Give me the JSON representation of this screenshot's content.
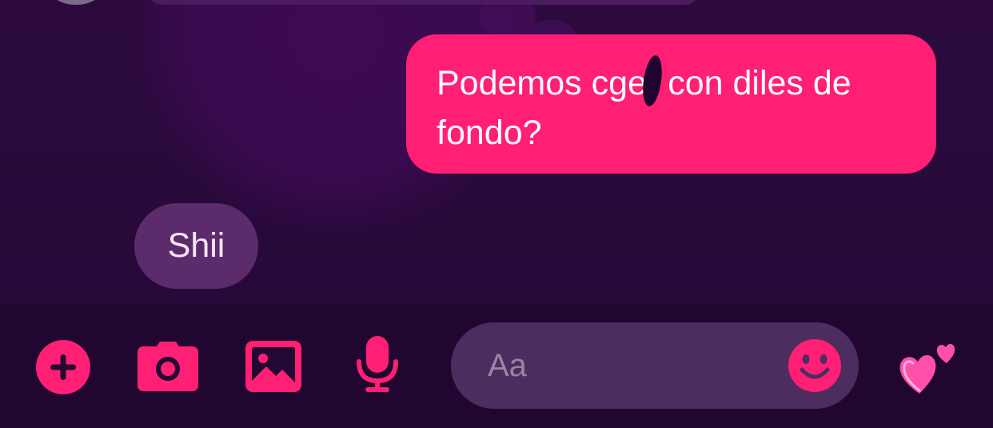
{
  "conversation": {
    "messages": [
      {
        "direction": "outgoing",
        "text_before": "Podemos c",
        "text_after": "ger con diles de fondo?"
      },
      {
        "direction": "incoming",
        "text": "Shii"
      }
    ]
  },
  "composer": {
    "placeholder": "Aa",
    "icons": [
      "add-icon",
      "camera-icon",
      "image-icon",
      "microphone-icon",
      "emoji-icon",
      "two-hearts-icon"
    ],
    "like_emoji": "💕"
  },
  "colors": {
    "accent": "#ff1f74",
    "background": "#250a36",
    "incoming_bubble": "#5c2b6c",
    "input_background": "#4d2c5f"
  }
}
